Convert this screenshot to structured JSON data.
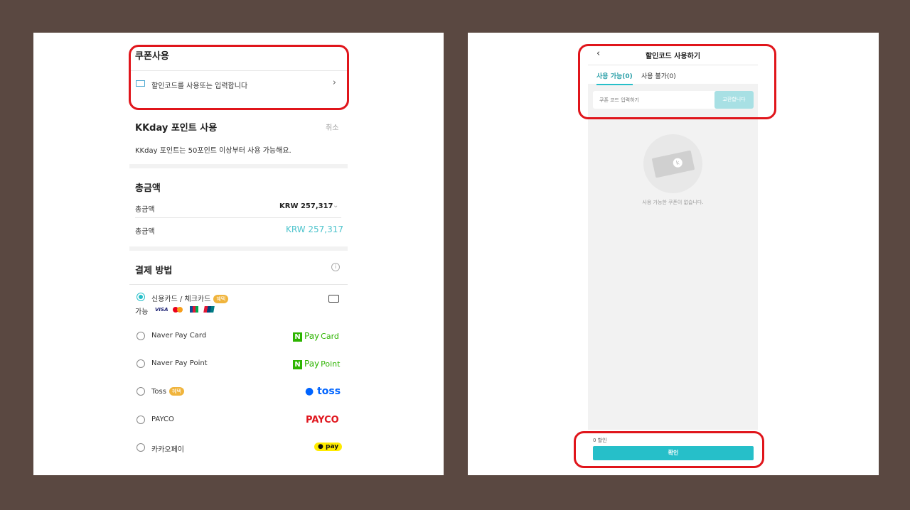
{
  "left": {
    "coupon": {
      "title": "쿠폰사용",
      "row_label": "할인코드를 사용또는 입력합니다"
    },
    "points": {
      "title": "KKday 포인트 사용",
      "cancel": "취소",
      "note": "KKday 포인트는 50포인트 이상부터 사용 가능해요."
    },
    "total": {
      "title": "총금액",
      "rows": [
        {
          "label": "총금액",
          "value": "KRW 257,317"
        },
        {
          "label": "총금액",
          "value": "KRW 257,317"
        }
      ]
    },
    "payment": {
      "title": "결제 방법",
      "methods": [
        {
          "label": "신용카드 / 체크카드",
          "badge": "혜택",
          "sub": "가능",
          "selected": true,
          "cards": [
            "VISA",
            "Mastercard",
            "JCB",
            "UnionPay"
          ]
        },
        {
          "label": "Naver Pay Card",
          "logo_n": "N",
          "logo_a": "Pay",
          "logo_b": "Card"
        },
        {
          "label": "Naver Pay Point",
          "logo_n": "N",
          "logo_a": "Pay",
          "logo_b": "Point"
        },
        {
          "label": "Toss",
          "badge": "혜택",
          "logo": "toss"
        },
        {
          "label": "PAYCO",
          "logo": "PAYCO"
        },
        {
          "label": "카카오페이",
          "logo": "pay"
        }
      ]
    }
  },
  "right": {
    "title": "할인코드 사용하기",
    "tabs": [
      {
        "label": "사용 가능(0)",
        "active": true
      },
      {
        "label": "사용 불가(0)"
      }
    ],
    "input_placeholder": "쿠폰 코드 입력하기",
    "redeem_button": "교환합니다",
    "empty_text": "사용 가능한 쿠폰이 없습니다.",
    "discount": "0 할인",
    "confirm": "확인"
  },
  "colors": {
    "accent": "#26bfc9",
    "highlight": "#e0151b",
    "background": "#5a4841"
  }
}
